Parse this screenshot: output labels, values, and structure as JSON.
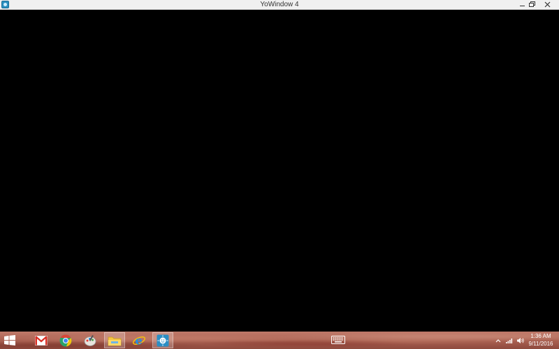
{
  "window": {
    "title": "YoWindow 4",
    "icon": "yowindow-icon",
    "controls": [
      "minimize-icon",
      "restore-icon",
      "close-icon"
    ]
  },
  "taskbar": {
    "start_icon": "windows-logo-icon",
    "apps": [
      {
        "name": "gmail-icon"
      },
      {
        "name": "chrome-icon"
      },
      {
        "name": "paint-icon"
      },
      {
        "name": "file-explorer-icon"
      },
      {
        "name": "internet-explorer-icon"
      },
      {
        "name": "yowindow-icon"
      }
    ],
    "tray_icons": [
      "show-hidden-icons-icon",
      "network-icon",
      "volume-icon"
    ],
    "keyboard_icon": "touch-keyboard-icon",
    "clock": {
      "time": "1:36 AM",
      "date": "9/11/2016"
    }
  },
  "colors": {
    "titlebar": "#f0f0f0",
    "content": "#000000",
    "taskbar_base": "#a85f50"
  }
}
